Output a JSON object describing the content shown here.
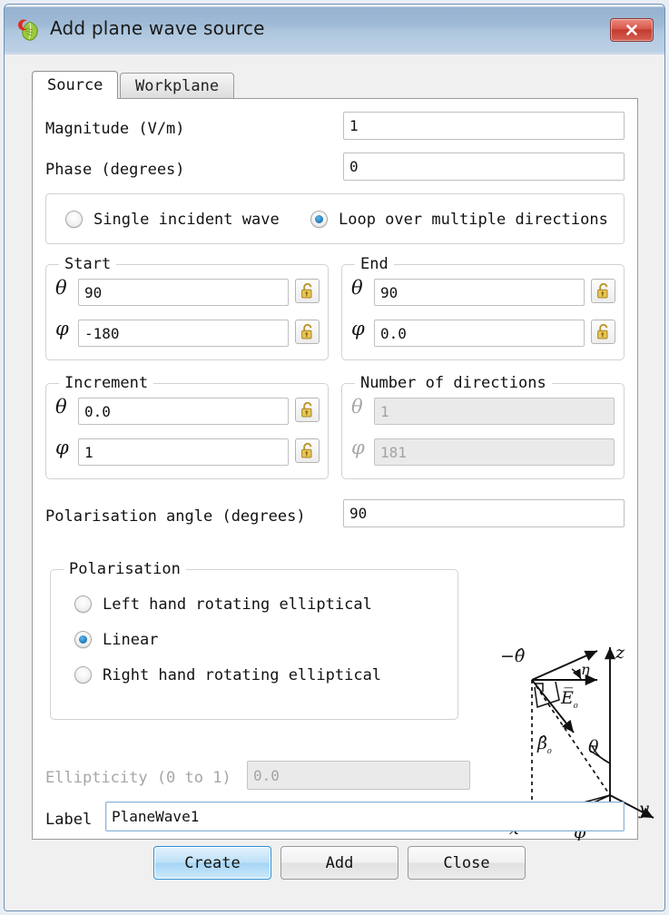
{
  "window": {
    "title": "Add plane wave source",
    "app_icon": "feko-leaf-icon",
    "close_label": "✕"
  },
  "tabs": [
    {
      "label": "Source",
      "active": true
    },
    {
      "label": "Workplane",
      "active": false
    }
  ],
  "form": {
    "magnitude": {
      "label": "Magnitude (V/m)",
      "value": "1"
    },
    "phase": {
      "label": "Phase (degrees)",
      "value": "0"
    }
  },
  "mode": {
    "options": [
      {
        "label": "Single incident wave",
        "selected": false
      },
      {
        "label": "Loop over multiple directions",
        "selected": true
      }
    ]
  },
  "start": {
    "title": "Start",
    "theta": {
      "symbol": "θ",
      "value": "90",
      "lock": "unlocked-padlock-icon"
    },
    "phi": {
      "symbol": "φ",
      "value": "-180",
      "lock": "unlocked-padlock-icon"
    }
  },
  "end": {
    "title": "End",
    "theta": {
      "symbol": "θ",
      "value": "90",
      "lock": "unlocked-padlock-icon"
    },
    "phi": {
      "symbol": "φ",
      "value": "0.0",
      "lock": "unlocked-padlock-icon"
    }
  },
  "increment": {
    "title": "Increment",
    "theta": {
      "symbol": "θ",
      "value": "0.0",
      "lock": "unlocked-padlock-icon"
    },
    "phi": {
      "symbol": "φ",
      "value": "1",
      "lock": "unlocked-padlock-icon"
    }
  },
  "directions": {
    "title": "Number of directions",
    "theta": {
      "symbol": "θ",
      "value": "1",
      "disabled": true
    },
    "phi": {
      "symbol": "φ",
      "value": "181",
      "disabled": true
    }
  },
  "polarisation_angle": {
    "label": "Polarisation angle (degrees)",
    "value": "90"
  },
  "polarisation": {
    "title": "Polarisation",
    "options": [
      {
        "label": "Left hand rotating elliptical",
        "selected": false
      },
      {
        "label": "Linear",
        "selected": true
      },
      {
        "label": "Right hand rotating elliptical",
        "selected": false
      }
    ]
  },
  "ellipticity": {
    "label": "Ellipticity (0 to 1)",
    "value": "0.0",
    "disabled": true
  },
  "label_field": {
    "label": "Label",
    "value": "PlaneWave1",
    "focused": true
  },
  "diagram": {
    "name": "plane-wave-coordinate-diagram",
    "labels": {
      "minus_theta_hat": "−θ̂",
      "eta": "η",
      "e_zero": "E̅₀",
      "beta_hat": "β̂₀",
      "theta": "θ",
      "phi": "φ",
      "x": "x",
      "y": "y",
      "z": "z"
    }
  },
  "buttons": [
    {
      "label": "Create",
      "style": "default"
    },
    {
      "label": "Add",
      "style": "normal"
    },
    {
      "label": "Close",
      "style": "normal"
    }
  ],
  "colors": {
    "title_gradient_top": "#95b2d0",
    "title_gradient_bottom": "#dce7f2",
    "close_button": "#c23b2e",
    "radio_selected": "#1c77b8",
    "default_button": "#a5d5f4",
    "lock_icon": "#d8b43a",
    "panel_background": "#ffffff",
    "disabled_field": "#eaeaea"
  }
}
